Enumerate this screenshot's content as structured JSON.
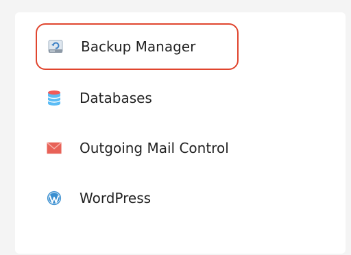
{
  "menu": {
    "items": [
      {
        "label": "Backup Manager",
        "icon": "backup-drive-icon",
        "highlighted": true
      },
      {
        "label": "Databases",
        "icon": "database-icon",
        "highlighted": false
      },
      {
        "label": "Outgoing Mail Control",
        "icon": "mail-envelope-icon",
        "highlighted": false
      },
      {
        "label": "WordPress",
        "icon": "wordpress-icon",
        "highlighted": false
      }
    ]
  },
  "colors": {
    "highlight_border": "#e0452e",
    "database": "#4ab0ef",
    "mail": "#e25a4e",
    "wordpress": "#3a8fd0",
    "drive": "#3b7fc4"
  }
}
